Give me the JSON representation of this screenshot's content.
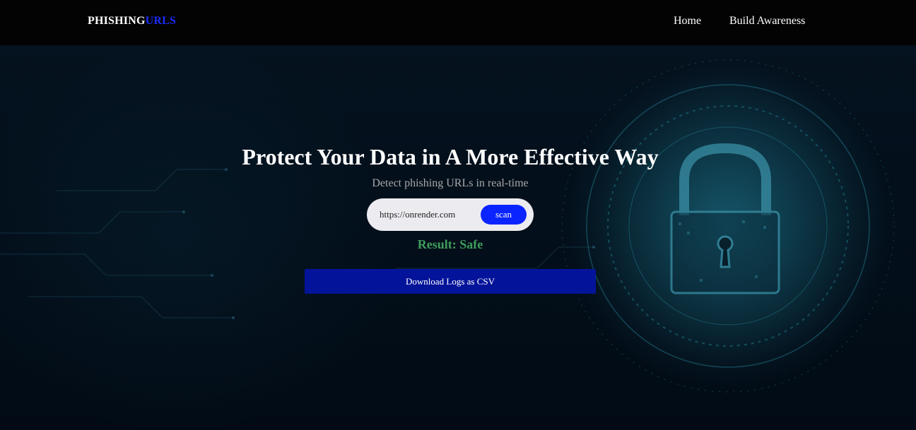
{
  "navbar": {
    "brand_primary": "PHISHING",
    "brand_accent": "URLS",
    "links": [
      {
        "label": "Home"
      },
      {
        "label": "Build Awareness"
      }
    ]
  },
  "hero": {
    "headline": "Protect Your Data in A More Effective Way",
    "subtitle": "Detect phishing URLs in real-time"
  },
  "scanner": {
    "url_value": "https://onrender.com",
    "scan_label": "scan",
    "result_text": "Result: Safe"
  },
  "actions": {
    "download_label": "Download Logs as CSV"
  },
  "colors": {
    "brand_accent": "#1a2bff",
    "scan_button": "#0a24ff",
    "result_safe": "#3f9e5c",
    "download_button": "#04149a",
    "navbar_bg": "#030303"
  },
  "background": {
    "image_subject": "padlock-icon"
  }
}
